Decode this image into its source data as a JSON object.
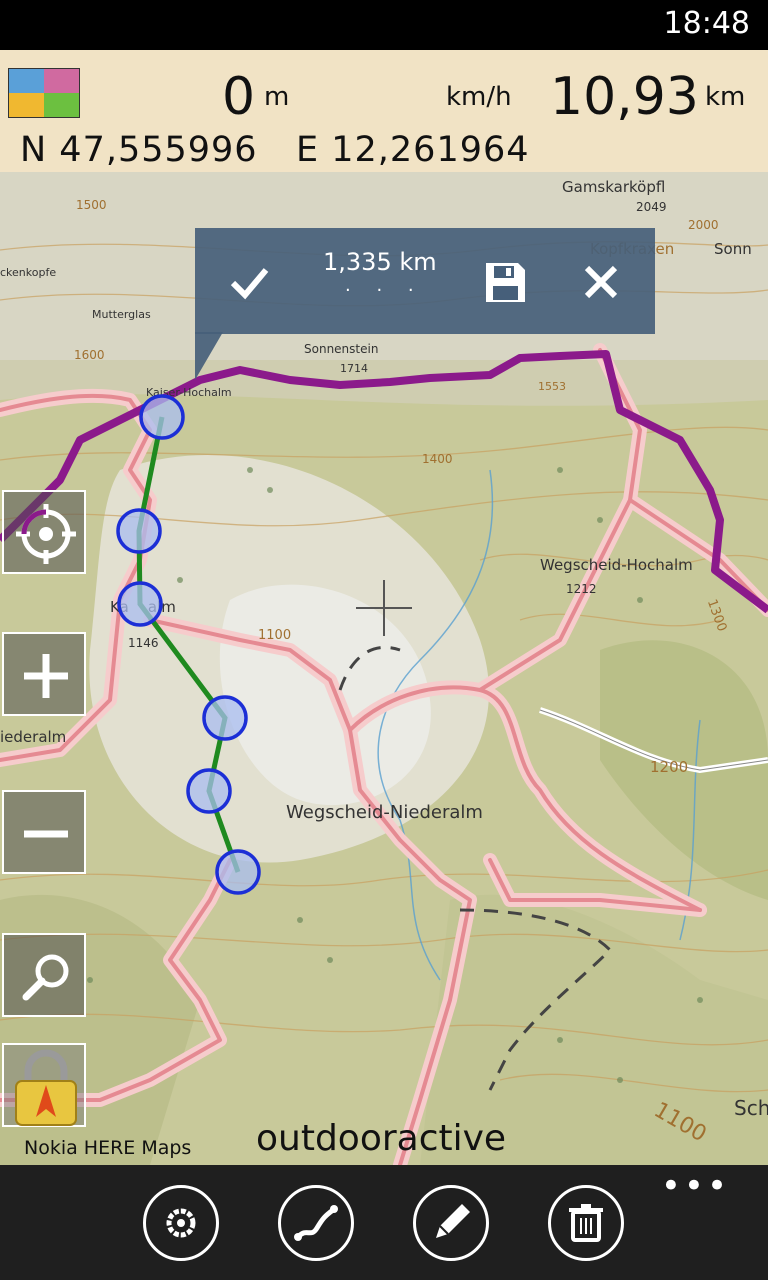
{
  "status_bar": {
    "time": "18:48"
  },
  "info_panel": {
    "altitude_value": "0",
    "altitude_unit": "m",
    "speed_unit": "km/h",
    "distance_value": "10,93",
    "distance_unit": "km",
    "latitude": "N 47,555996",
    "longitude": "E 12,261964",
    "layer_colors": [
      "#5aa0d8",
      "#d06aa0",
      "#f0b830",
      "#6cc040"
    ]
  },
  "route_popup": {
    "distance": "1,335 km",
    "dots": "· · ·",
    "icons": [
      "check-icon",
      "save-icon",
      "close-icon"
    ]
  },
  "map_labels": {
    "peak_gamskarkoepfl": "Gamskarköpfl",
    "peak_kopfkraxen": "Kopfkraxen",
    "sonnenstein": "Sonnenstein",
    "sonnenstein_alt": "1714",
    "kaiser_hochalm": "Kaiser-Hochalm",
    "kaiser_niederalm_short": "Ka    alm",
    "kaiser_niederalm_alt": "1146",
    "wegscheid_hochalm": "Wegscheid-Hochalm",
    "wegscheid_hochalm_alt": "1212",
    "wegscheid_niederalm": "Wegscheid-Niederalm",
    "niederalm_left": "iederalm",
    "contour_1400": "1400",
    "contour_1300": "1300",
    "contour_1200": "1200",
    "contour_1100_a": "1100",
    "contour_1100_b": "1100",
    "contour_1600": "1600",
    "contour_1500": "1500",
    "contour_2000": "2000",
    "contour_2049": "2049",
    "contour_1553": "1553",
    "partial_sonn": "Sonn",
    "partial_sch": "Sch",
    "wiesberg": "Wiesberg",
    "mutterglas": "Mutterglas",
    "ackenkopfe": "ckenkopfe"
  },
  "side_buttons": [
    "locate-icon",
    "zoom-in-icon",
    "zoom-out-icon",
    "search-icon",
    "lock-compass-icon"
  ],
  "attribution": "Nokia HERE Maps",
  "map_provider": "outdooractive",
  "app_bar": {
    "buttons": [
      "settings-icon",
      "route-icon",
      "edit-icon",
      "delete-icon"
    ],
    "more": "•••"
  },
  "colors": {
    "route_purple": "#8b1a8b",
    "track_green": "#1f8a1f",
    "waypoint_blue": "#1c2fd6",
    "road_pink": "#e89aa0"
  }
}
